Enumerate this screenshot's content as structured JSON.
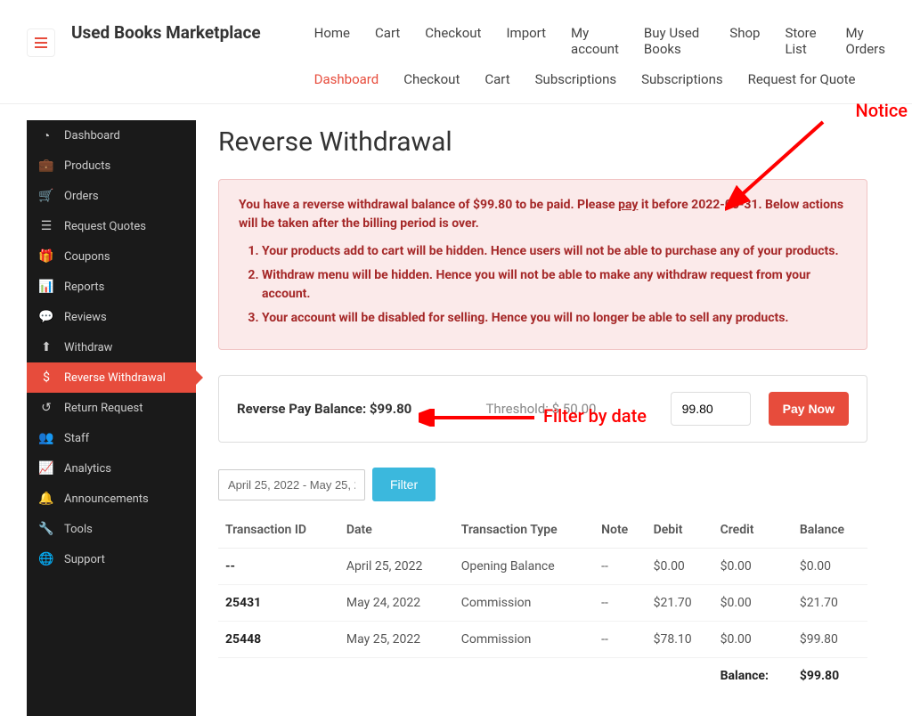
{
  "brand": "Used Books Marketplace",
  "topnav": {
    "row1": [
      "Home",
      "Cart",
      "Checkout",
      "Import",
      "My account",
      "Buy Used Books",
      "Shop",
      "Store List",
      "My Orders"
    ],
    "row2": [
      "Dashboard",
      "Checkout",
      "Cart",
      "Subscriptions",
      "Subscriptions",
      "Request for Quote"
    ]
  },
  "sidebar": [
    {
      "label": "Dashboard",
      "icon": "dashboard"
    },
    {
      "label": "Products",
      "icon": "briefcase"
    },
    {
      "label": "Orders",
      "icon": "cart"
    },
    {
      "label": "Request Quotes",
      "icon": "list"
    },
    {
      "label": "Coupons",
      "icon": "gift"
    },
    {
      "label": "Reports",
      "icon": "chart"
    },
    {
      "label": "Reviews",
      "icon": "comment"
    },
    {
      "label": "Withdraw",
      "icon": "upload"
    },
    {
      "label": "Reverse Withdrawal",
      "icon": "dollar",
      "active": true
    },
    {
      "label": "Return Request",
      "icon": "undo"
    },
    {
      "label": "Staff",
      "icon": "users"
    },
    {
      "label": "Analytics",
      "icon": "analytics"
    },
    {
      "label": "Announcements",
      "icon": "bell"
    },
    {
      "label": "Tools",
      "icon": "wrench"
    },
    {
      "label": "Support",
      "icon": "globe"
    }
  ],
  "page": {
    "title": "Reverse Withdrawal"
  },
  "notice": {
    "text_before_pay": "You have a reverse withdrawal balance of $99.80 to be paid. Please ",
    "pay_word": "pay",
    "text_after_pay": " it before 2022-05-31. Below actions will be taken after the billing period is over.",
    "items": [
      "Your products add to cart will be hidden. Hence users will not be able to purchase any of your products.",
      "Withdraw menu will be hidden. Hence you will not be able to make any withdraw request from your account.",
      "Your account will be disabled for selling. Hence you will no longer be able to sell any products."
    ]
  },
  "balance_bar": {
    "label": "Reverse Pay Balance: $99.80",
    "threshold": "Threshold: $ 50.00",
    "amount": "99.80",
    "button": "Pay Now"
  },
  "filter": {
    "date_range": "April 25, 2022 - May 25, 2",
    "button": "Filter"
  },
  "table": {
    "headers": [
      "Transaction ID",
      "Date",
      "Transaction Type",
      "Note",
      "Debit",
      "Credit",
      "Balance"
    ],
    "rows": [
      {
        "tid": "--",
        "date": "April 25, 2022",
        "type": "Opening Balance",
        "note": "--",
        "debit": "$0.00",
        "credit": "$0.00",
        "balance": "$0.00"
      },
      {
        "tid": "25431",
        "date": "May 24, 2022",
        "type": "Commission",
        "note": "--",
        "debit": "$21.70",
        "credit": "$0.00",
        "balance": "$21.70"
      },
      {
        "tid": "25448",
        "date": "May 25, 2022",
        "type": "Commission",
        "note": "--",
        "debit": "$78.10",
        "credit": "$0.00",
        "balance": "$99.80"
      }
    ],
    "footer": {
      "label": "Balance:",
      "value": "$99.80"
    }
  },
  "annotations": {
    "notice": "Notice",
    "filter": "Filter by date"
  },
  "icons": {
    "dashboard": "◔",
    "briefcase": "💼",
    "cart": "🛒",
    "list": "☰",
    "gift": "🎁",
    "chart": "📊",
    "comment": "💬",
    "upload": "⬆",
    "dollar": "$",
    "undo": "↺",
    "users": "👥",
    "analytics": "📈",
    "bell": "🔔",
    "wrench": "🔧",
    "globe": "🌐"
  }
}
